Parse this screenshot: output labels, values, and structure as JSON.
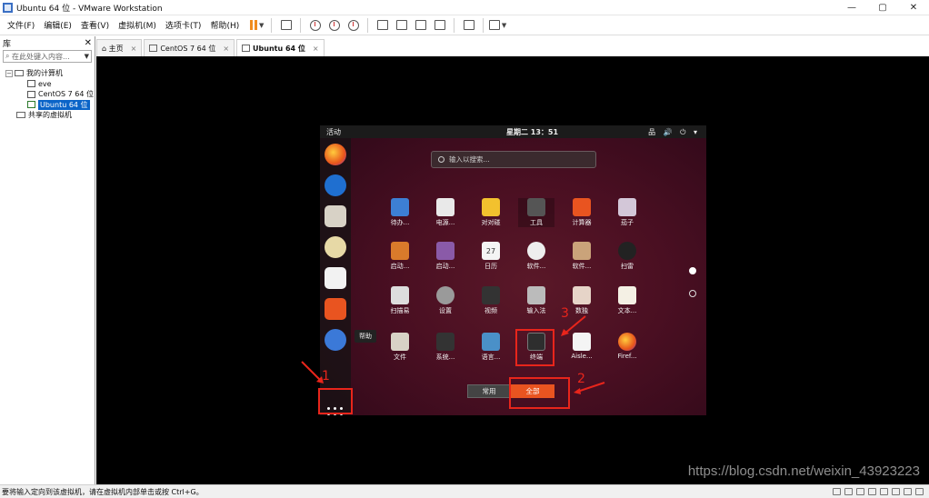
{
  "window": {
    "title": "Ubuntu 64 位 - VMware Workstation",
    "controls": [
      "—",
      "▢",
      "✕"
    ]
  },
  "menu": [
    "文件(F)",
    "编辑(E)",
    "查看(V)",
    "虚拟机(M)",
    "选项卡(T)",
    "帮助(H)"
  ],
  "library": {
    "title": "库",
    "close": "✕",
    "search_placeholder": "在此处键入内容...",
    "tree": {
      "root": "我的计算机",
      "children": [
        "eve",
        "CentOS 7 64 位",
        "Ubuntu 64 位"
      ],
      "shared": "共享的虚拟机"
    }
  },
  "tabs": [
    {
      "label": "主页",
      "active": false
    },
    {
      "label": "CentOS 7 64 位",
      "active": false
    },
    {
      "label": "Ubuntu 64 位",
      "active": true
    }
  ],
  "guest": {
    "activities": "活动",
    "clock": "星期二 13：51",
    "tray": "品 🔊 ⏻ ▾",
    "search_placeholder": "输入以搜索...",
    "help_tooltip": "帮助",
    "apps": [
      [
        "待办...",
        "电源...",
        "对对碰",
        "工具",
        "计算器",
        "茄子"
      ],
      [
        "启动...",
        "启动...",
        "日历",
        "软件...",
        "软件...",
        "扫雷"
      ],
      [
        "扫描易",
        "设置",
        "视频",
        "输入法",
        "数独",
        "文本..."
      ],
      [
        "文件",
        "系统...",
        "语言...",
        "终端",
        "Aisle...",
        "Firef..."
      ]
    ],
    "calendar_day": "27",
    "switch": {
      "frequent": "常用",
      "all": "全部"
    }
  },
  "annotations": {
    "n1": "1",
    "n2": "2",
    "n3": "3"
  },
  "watermark": "https://blog.csdn.net/weixin_43923223",
  "status": "要将输入定向到该虚拟机，请在虚拟机内部单击或按 Ctrl+G。",
  "colors": {
    "ubuntu_orange": "#e95420",
    "annotation_red": "#e8251b",
    "selection_blue": "#0a64c8"
  }
}
